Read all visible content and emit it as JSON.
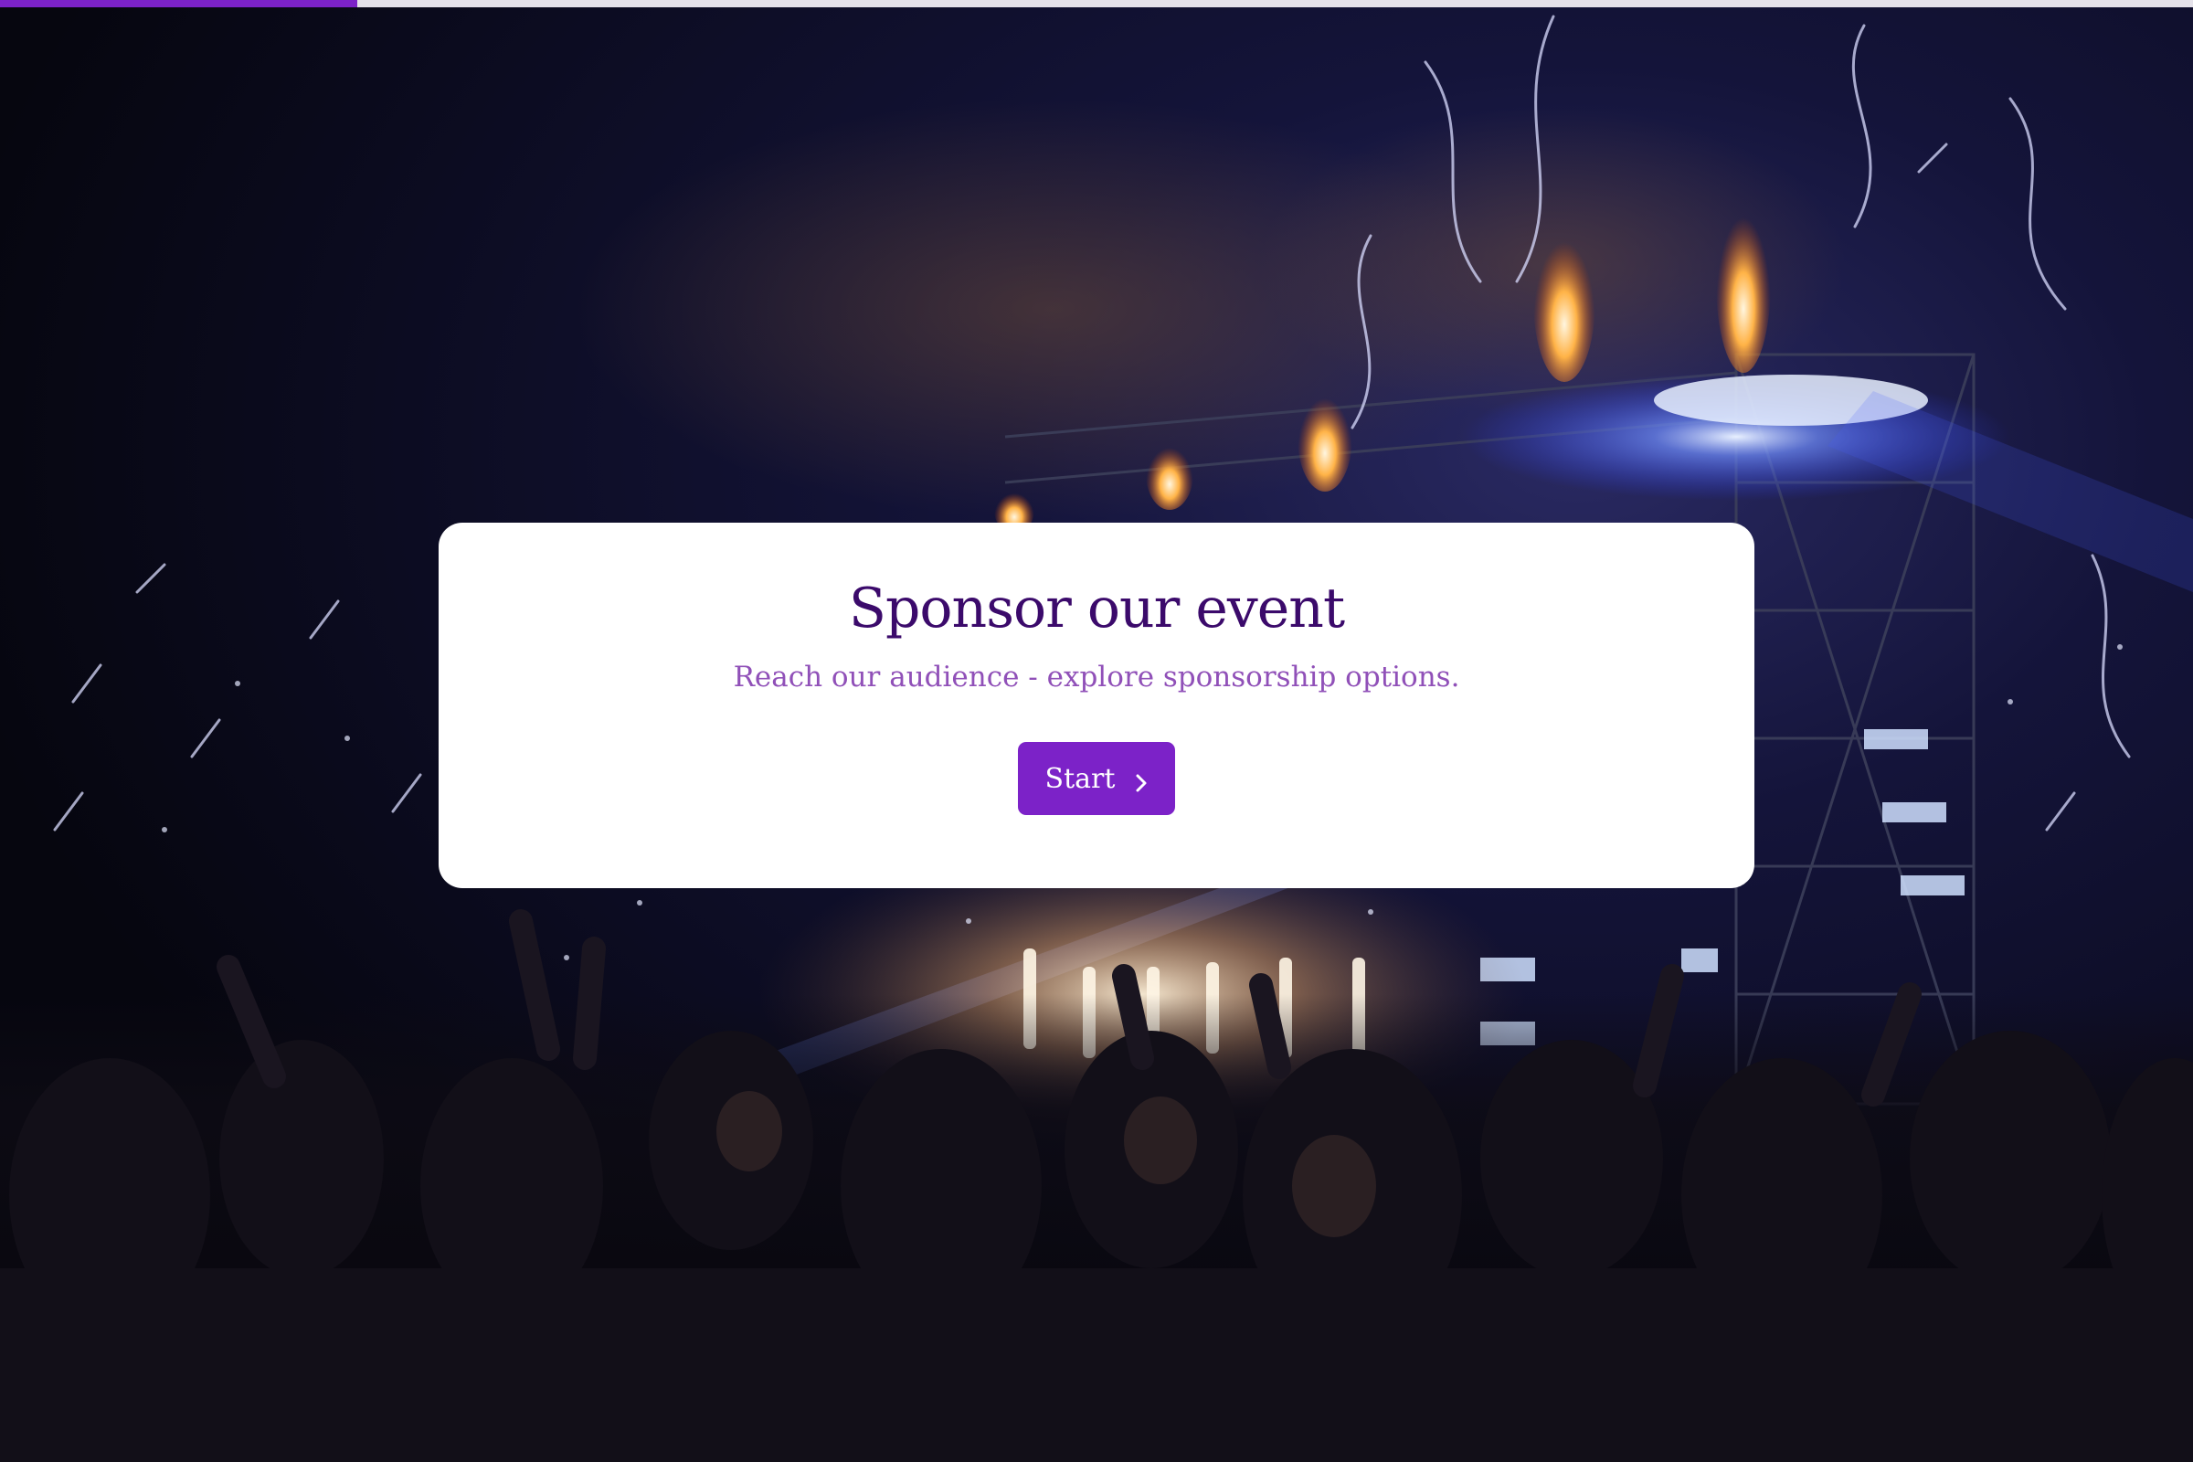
{
  "progress": {
    "value": 0.163,
    "fill_color": "#7c22c8",
    "track_color": "#e5e2ea"
  },
  "background": {
    "icon": "concert-crowd-image"
  },
  "card": {
    "title": "Sponsor our event",
    "subtitle": "Reach our audience - explore sponsorship options.",
    "start_button": {
      "label": "Start",
      "icon": "chevron-right-icon"
    }
  },
  "colors": {
    "accent": "#7c22c8",
    "title": "#3b0a6b",
    "subtitle": "#9050b8"
  }
}
